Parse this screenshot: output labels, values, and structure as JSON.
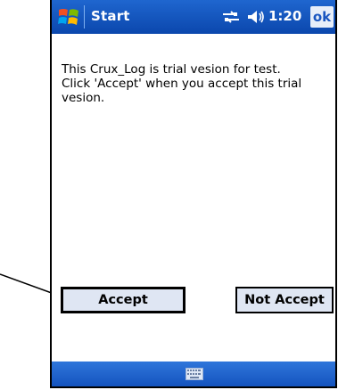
{
  "title_bar": {
    "start_label": "Start",
    "clock": "1:20",
    "ok_label": "ok",
    "icons": [
      "windows-flag-icon",
      "connectivity-icon",
      "volume-icon"
    ]
  },
  "dialog": {
    "message_lines": [
      "This Crux_Log is trial vesion for test.",
      "Click 'Accept' when you accept this trial",
      "vesion."
    ],
    "accept_label": "Accept",
    "not_accept_label": "Not Accept"
  },
  "bottom_bar": {
    "icon": "keyboard-icon"
  },
  "colors": {
    "title_bar": "#0b47ad",
    "bottom_bar": "#1453be",
    "button_fill": "#dfe6f3"
  }
}
